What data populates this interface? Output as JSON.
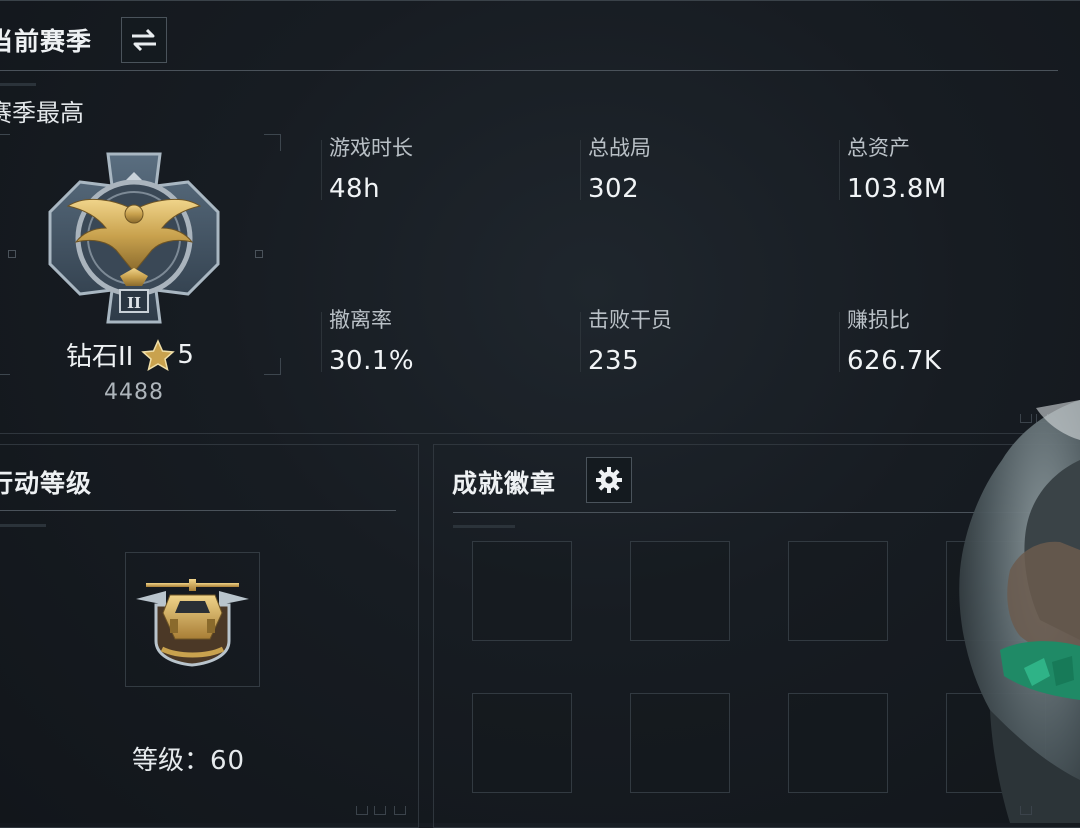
{
  "season": {
    "title": "当前赛季",
    "subtitle": "赛季最高",
    "rank_name": "钻石II",
    "rank_stars": "5",
    "rank_points": "4488"
  },
  "stats": [
    {
      "label": "游戏时长",
      "value": "48h"
    },
    {
      "label": "总战局",
      "value": "302"
    },
    {
      "label": "总资产",
      "value": "103.8M"
    },
    {
      "label": "撤离率",
      "value": "30.1%"
    },
    {
      "label": "击败干员",
      "value": "235"
    },
    {
      "label": "赚损比",
      "value": "626.7K"
    }
  ],
  "operation": {
    "title": "行动等级",
    "level_label": "等级：",
    "level_value": "60"
  },
  "achievements": {
    "title": "成就徽章",
    "slot_count": 8
  },
  "colors": {
    "gold": "#c9a24e",
    "panel_border": "#2f363d",
    "teal_accent": "#1f8a66"
  }
}
